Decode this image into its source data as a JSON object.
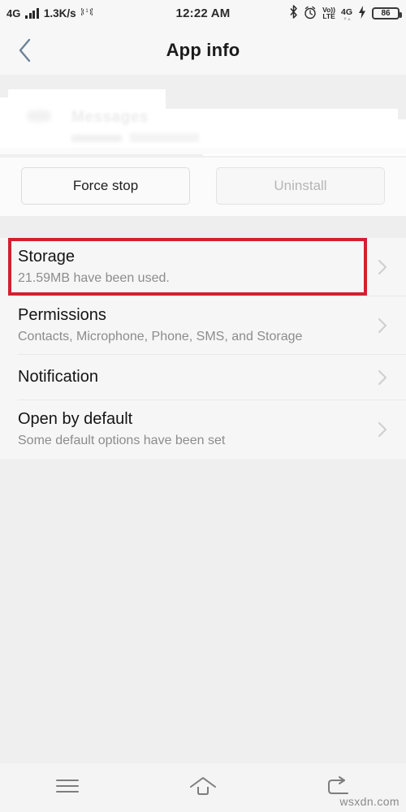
{
  "statusbar": {
    "network_type": "4G",
    "data_rate": "1.3K/s",
    "signal_icon": "signal-bars-icon",
    "hotspot_icon": "hotspot-icon",
    "time": "12:22 AM",
    "bluetooth_icon": "bluetooth-icon",
    "alarm_icon": "alarm-clock-icon",
    "volte_line1": "Vo))",
    "volte_line2": "LTE",
    "data_network": "4G",
    "data_arrows": "▼▲",
    "charging_icon": "charging-bolt-icon",
    "battery_level": "86"
  },
  "titlebar": {
    "back_icon": "back-chevron-icon",
    "title": "App info"
  },
  "app_header": {
    "app_name": "Messages",
    "censored": true
  },
  "actions": {
    "force_stop_label": "Force stop",
    "uninstall_label": "Uninstall"
  },
  "settings_list": [
    {
      "title": "Storage",
      "subtitle": "21.59MB have been used.",
      "chevron": "chevron-right-icon",
      "highlighted": true
    },
    {
      "title": "Permissions",
      "subtitle": "Contacts, Microphone, Phone, SMS, and Storage",
      "chevron": "chevron-right-icon",
      "highlighted": false
    },
    {
      "title": "Notification",
      "subtitle": "",
      "chevron": "chevron-right-icon",
      "highlighted": false
    },
    {
      "title": "Open by default",
      "subtitle": "Some default options have been set",
      "chevron": "chevron-right-icon",
      "highlighted": false
    }
  ],
  "annotation": {
    "color": "#d32030",
    "target": "Storage"
  },
  "navbar": {
    "menu_icon": "menu-icon",
    "home_icon": "home-icon",
    "back_icon": "back-arrow-icon"
  },
  "watermark": "wsxdn.com"
}
